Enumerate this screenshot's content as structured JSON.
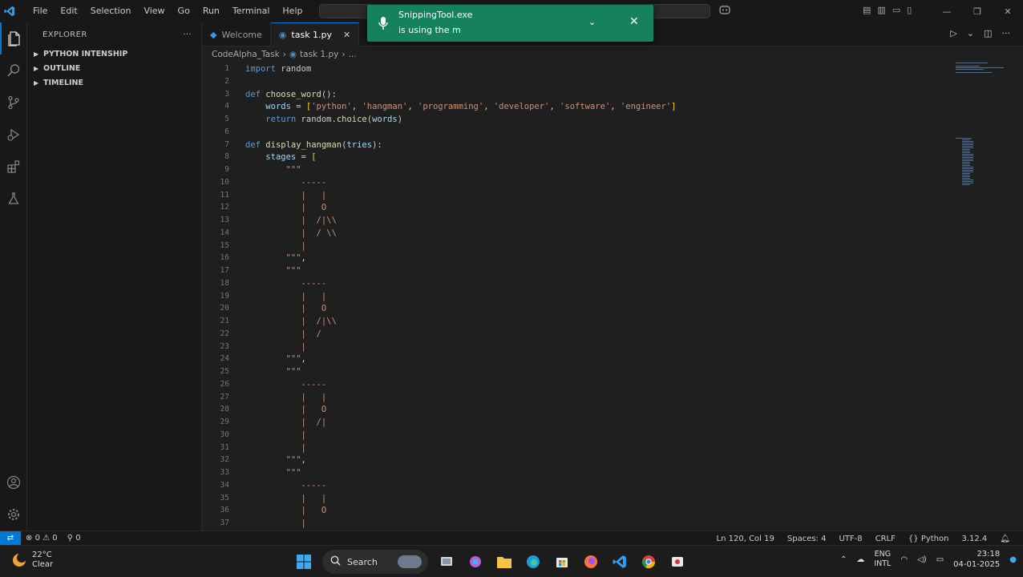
{
  "menu": [
    "File",
    "Edit",
    "Selection",
    "View",
    "Go",
    "Run",
    "Terminal",
    "Help"
  ],
  "sidebar": {
    "title": "EXPLORER",
    "sections": [
      "PYTHON INTENSHIP",
      "OUTLINE",
      "TIMELINE"
    ]
  },
  "tabs": [
    {
      "label": "Welcome",
      "active": false
    },
    {
      "label": "task 1.py",
      "active": true
    }
  ],
  "breadcrumb": {
    "folder": "CodeAlpha_Task",
    "file": "task 1.py",
    "rest": "..."
  },
  "notification": {
    "title": "SnippingTool.exe",
    "subtitle": "is using the m"
  },
  "code": [
    {
      "n": "1",
      "html": "<span class='kw'>import</span> random"
    },
    {
      "n": "2",
      "html": ""
    },
    {
      "n": "3",
      "html": "<span class='kw'>def</span> <span class='fn'>choose_word</span>():"
    },
    {
      "n": "4",
      "html": "    <span class='var'>words</span> = <span class='br'>[</span><span class='str'>'python'</span>, <span class='str'>'hangman'</span>, <span class='str'>'programming'</span>, <span class='str'>'developer'</span>, <span class='str'>'software'</span>, <span class='str'>'engineer'</span><span class='br'>]</span>"
    },
    {
      "n": "5",
      "html": "    <span class='kw'>return</span> random.<span class='fn'>choice</span>(<span class='var'>words</span>)"
    },
    {
      "n": "6",
      "html": ""
    },
    {
      "n": "7",
      "html": "<span class='kw'>def</span> <span class='fn'>display_hangman</span>(<span class='var'>tries</span>):"
    },
    {
      "n": "8",
      "html": "    <span class='var'>stages</span> = <span class='br'>[</span>"
    },
    {
      "n": "9",
      "html": "        <span class='str'>\"\"\"</span>"
    },
    {
      "n": "10",
      "html": "<span class='str'>           -----</span>"
    },
    {
      "n": "11",
      "html": "<span class='str'>           |   |</span>"
    },
    {
      "n": "12",
      "html": "<span class='str'>           |   O</span>"
    },
    {
      "n": "13",
      "html": "<span class='str'>           |  /|\\\\</span>"
    },
    {
      "n": "14",
      "html": "<span class='str'>           |  / \\\\</span>"
    },
    {
      "n": "15",
      "html": "<span class='str'>           |</span>"
    },
    {
      "n": "16",
      "html": "<span class='str'>        \"\"\"</span>,"
    },
    {
      "n": "17",
      "html": "<span class='str'>        \"\"\"</span>"
    },
    {
      "n": "18",
      "html": "<span class='str'>           -----</span>"
    },
    {
      "n": "19",
      "html": "<span class='str'>           |   |</span>"
    },
    {
      "n": "20",
      "html": "<span class='str'>           |   O</span>"
    },
    {
      "n": "21",
      "html": "<span class='str'>           |  /|\\\\</span>"
    },
    {
      "n": "22",
      "html": "<span class='str'>           |  /</span>"
    },
    {
      "n": "23",
      "html": "<span class='str'>           |</span>"
    },
    {
      "n": "24",
      "html": "<span class='str'>        \"\"\"</span>,"
    },
    {
      "n": "25",
      "html": "<span class='str'>        \"\"\"</span>"
    },
    {
      "n": "26",
      "html": "<span class='str'>           -----</span>"
    },
    {
      "n": "27",
      "html": "<span class='str'>           |   |</span>"
    },
    {
      "n": "28",
      "html": "<span class='str'>           |   O</span>"
    },
    {
      "n": "29",
      "html": "<span class='str'>           |  /|</span>"
    },
    {
      "n": "30",
      "html": "<span class='str'>           |</span>"
    },
    {
      "n": "31",
      "html": "<span class='str'>           |</span>"
    },
    {
      "n": "32",
      "html": "<span class='str'>        \"\"\"</span>,"
    },
    {
      "n": "33",
      "html": "<span class='str'>        \"\"\"</span>"
    },
    {
      "n": "34",
      "html": "<span class='str'>           -----</span>"
    },
    {
      "n": "35",
      "html": "<span class='str'>           |   |</span>"
    },
    {
      "n": "36",
      "html": "<span class='str'>           |   O</span>"
    },
    {
      "n": "37",
      "html": "<span class='str'>           |</span>"
    }
  ],
  "status": {
    "errors": "0",
    "warnings": "0",
    "ports": "0",
    "position": "Ln 120, Col 19",
    "spaces": "Spaces: 4",
    "encoding": "UTF-8",
    "eol": "CRLF",
    "language": "Python",
    "version": "3.12.4"
  },
  "taskbar": {
    "temp": "22°C",
    "weather": "Clear",
    "search_label": "Search",
    "lang1": "ENG",
    "lang2": "INTL",
    "time": "23:18",
    "date": "04-01-2025"
  },
  "colors": {
    "accent": "#0078d4",
    "notification": "#16825d"
  }
}
